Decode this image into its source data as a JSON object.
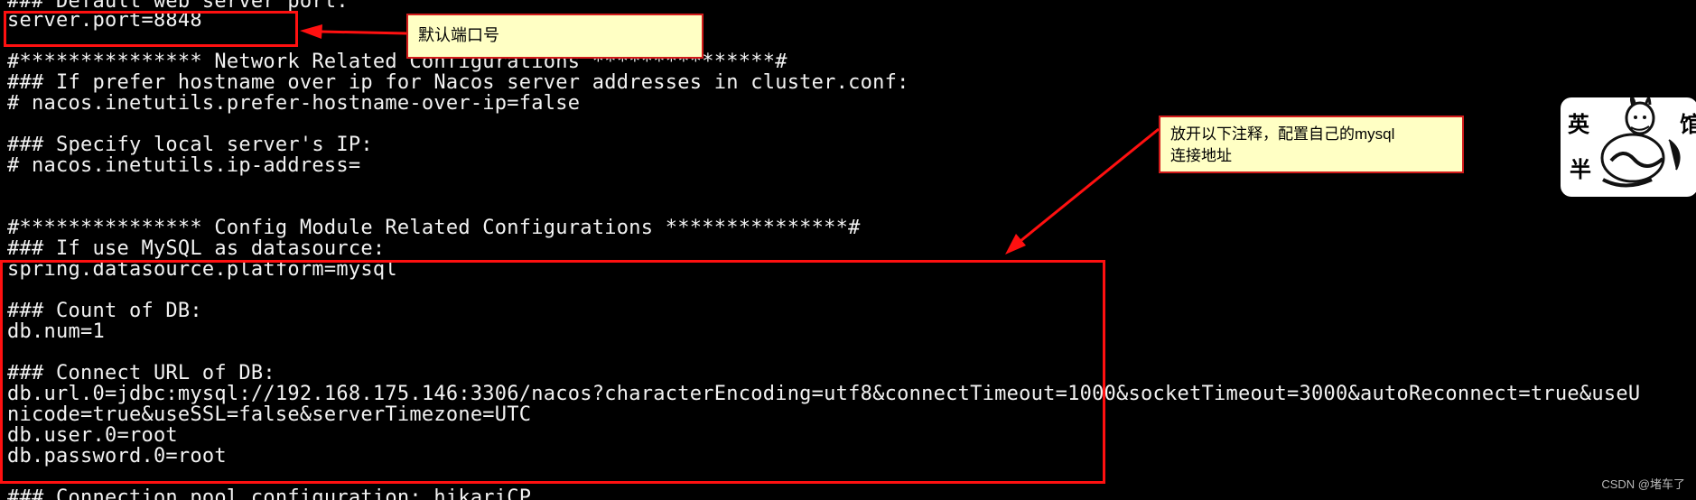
{
  "terminal": {
    "lines": [
      "### Default web server port:",
      "server.port=8848",
      "",
      "#*************** Network Related Configurations ***************#",
      "### If prefer hostname over ip for Nacos server addresses in cluster.conf:",
      "# nacos.inetutils.prefer-hostname-over-ip=false",
      "",
      "### Specify local server's IP:",
      "# nacos.inetutils.ip-address=",
      "",
      "",
      "#*************** Config Module Related Configurations ***************#",
      "### If use MySQL as datasource:",
      "spring.datasource.platform=mysql",
      "",
      "### Count of DB:",
      "db.num=1",
      "",
      "### Connect URL of DB:",
      "db.url.0=jdbc:mysql://192.168.175.146:3306/nacos?characterEncoding=utf8&connectTimeout=1000&socketTimeout=3000&autoReconnect=true&useU",
      "nicode=true&useSSL=false&serverTimezone=UTC",
      "db.user.0=root",
      "db.password.0=root",
      "",
      "### Connection pool configuration: hikariCP"
    ]
  },
  "annotations": {
    "port_callout": {
      "lines": [
        "默认端口号"
      ]
    },
    "mysql_callout": {
      "lines": [
        "放开以下注释，配置自己的mysql",
        "连接地址"
      ]
    }
  },
  "sticker": {
    "characters": [
      "英",
      "半",
      "馆"
    ]
  },
  "watermark": "CSDN @堵车了",
  "colors": {
    "background": "#000000",
    "terminal_text": "#f2f2f2",
    "highlight": "#ff1010",
    "callout_fill": "#ffffc4",
    "callout_border": "#d21b1b"
  },
  "icons": {
    "sticker": "cartoon-rabbit-sticker"
  }
}
